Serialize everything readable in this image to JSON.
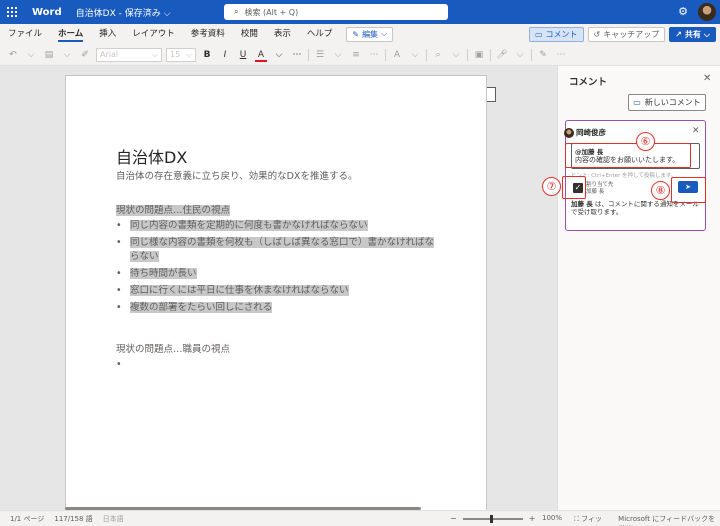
{
  "titlebar": {
    "app_name": "Word",
    "doc_title": "自治体DX - 保存済み ⌵",
    "search_placeholder": "検索 (Alt + Q)"
  },
  "ribbon": {
    "tabs": [
      "ファイル",
      "ホーム",
      "挿入",
      "レイアウト",
      "参考資料",
      "校閲",
      "表示",
      "ヘルプ"
    ],
    "active_tab": "ホーム",
    "edit_mode_label": "編集",
    "comments_label": "コメント",
    "catchup_label": "キャッチアップ",
    "share_label": "共有"
  },
  "toolbar": {
    "font_name": "Arial",
    "font_size": "15",
    "bold": "B",
    "italic": "I",
    "underline": "U",
    "font_color": "A",
    "more": "⋯"
  },
  "document": {
    "heading": "自治体DX",
    "subtitle": "自治体の存在意義に立ち戻り、効果的なDXを推進する。",
    "section1_title": "現状の問題点…住民の視点",
    "section1_items": [
      "同じ内容の書類を定期的に何度も書かなければならない",
      "同じ様な内容の書類を何枚も（しばしば異なる窓口で）書かなければならない",
      "待ち時間が長い",
      "窓口に行くには平日に仕事を休まなければならない",
      "複数の部署をたらい回しにされる"
    ],
    "section2_title": "現状の問題点…職員の視点",
    "section2_items": [
      ""
    ]
  },
  "comments_pane": {
    "title": "コメント",
    "new_comment_label": "新しいコメント",
    "card": {
      "author": "岡崎俊彦",
      "mention": "@加藤 長",
      "text": "内容の確認をお願いいたします。",
      "hint": "ヒント: Ctrl+Enter を押して投稿します。",
      "assign_line1": "割り当て先",
      "assign_line2": "加藤 長",
      "notify_name": "加藤 長",
      "notify_text": " は、コメントに関する通知をメールで受け取ります。"
    }
  },
  "annotations": {
    "n6": "⑥",
    "n7": "⑦",
    "n8": "⑧",
    "color": "#e0302a"
  },
  "statusbar": {
    "page": "1/1 ページ",
    "words": "117/158 語",
    "language": "日本語",
    "zoom_percent": "100%",
    "fit": "フィット",
    "feedback": "Microsoft にフィードバックを送信"
  },
  "colors": {
    "brand": "#185abd",
    "highlight": "#c8c8c8",
    "comment_card_border": "#9b4fa8"
  }
}
